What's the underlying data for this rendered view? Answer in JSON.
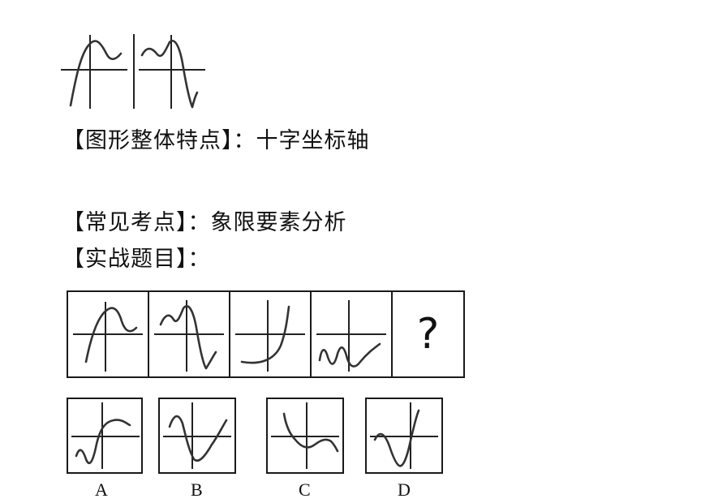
{
  "sections": {
    "feature_label": "【图形整体特点】：",
    "feature_value": "十字坐标轴",
    "common_label": "【常见考点】：",
    "common_value": "象限要素分析",
    "practice_label": "【实战题目】："
  },
  "sequence": {
    "question_mark": "?"
  },
  "options": [
    "A",
    "B",
    "C",
    "D"
  ]
}
